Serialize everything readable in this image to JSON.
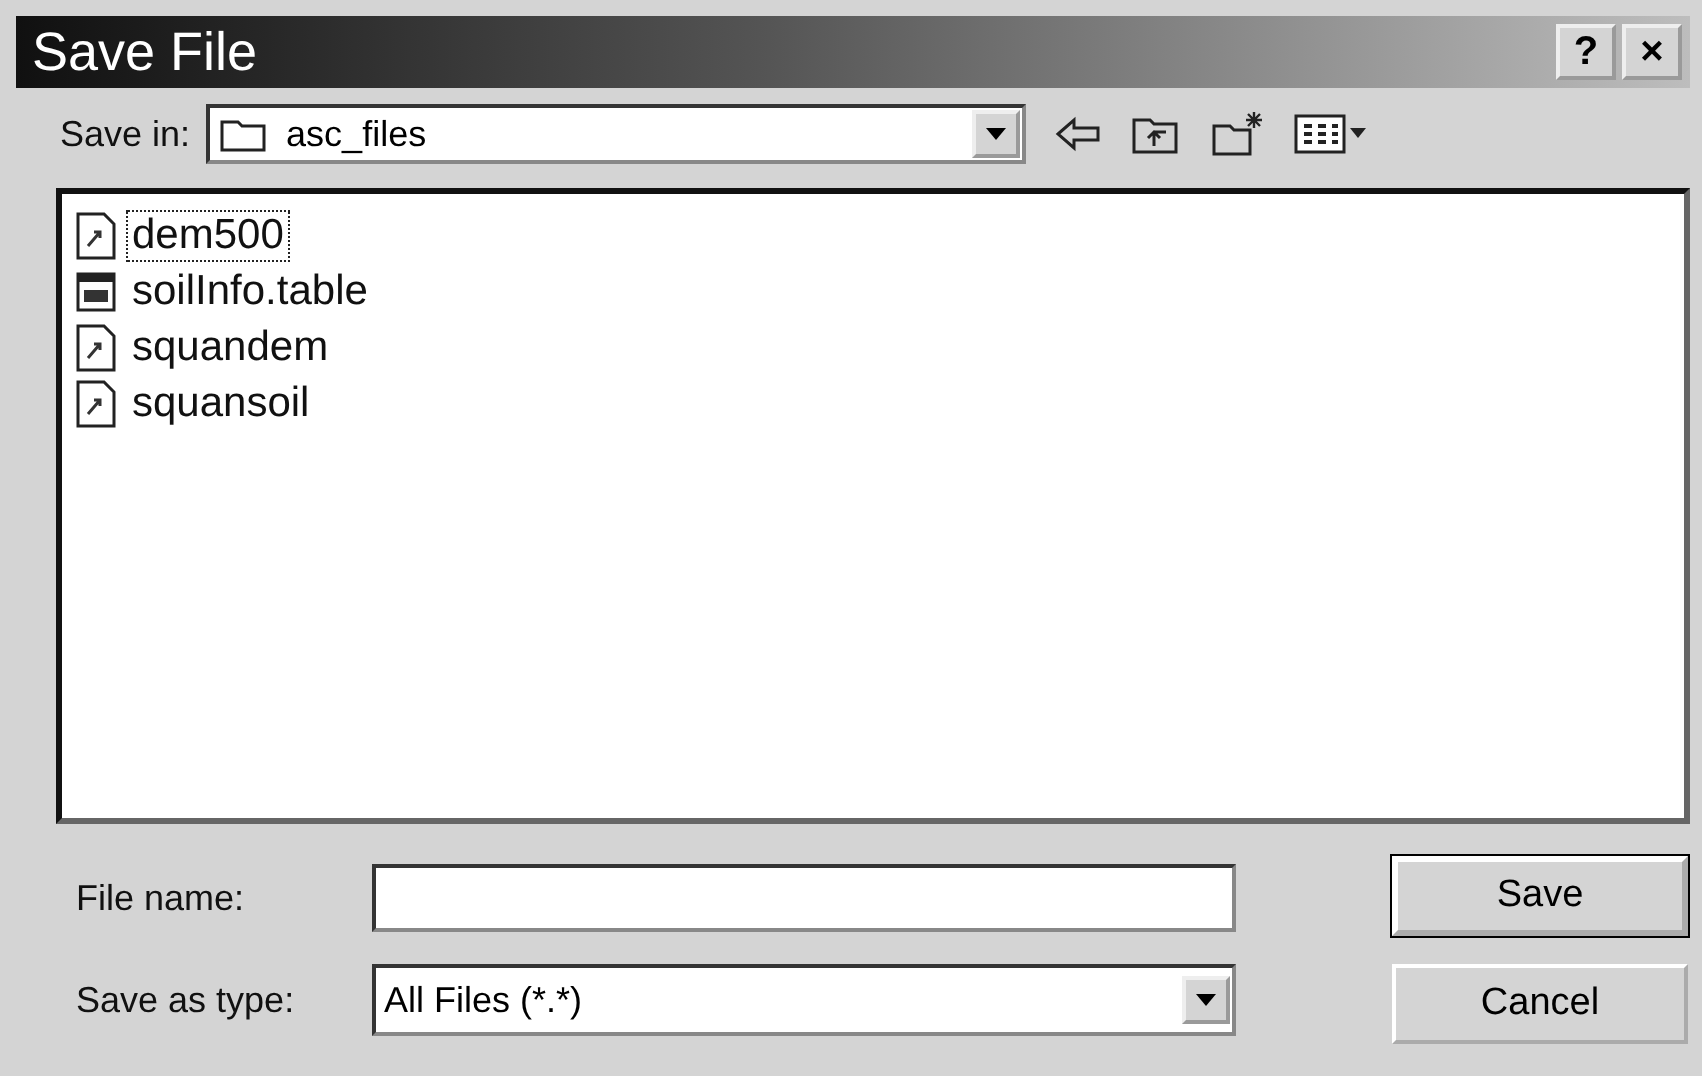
{
  "window": {
    "title": "Save File",
    "buttons": [
      "?",
      "×"
    ]
  },
  "save_in": {
    "label": "Save in:",
    "value": "asc_files"
  },
  "files": [
    {
      "name": "dem500",
      "kind": "data",
      "selected": true
    },
    {
      "name": "soilInfo.table",
      "kind": "table",
      "selected": false
    },
    {
      "name": "squandem",
      "kind": "data",
      "selected": false
    },
    {
      "name": "squansoil",
      "kind": "data",
      "selected": false
    }
  ],
  "file_name": {
    "label": "File name:"
  },
  "save_as_type": {
    "label": "Save as type:",
    "value": "All Files (*.*)"
  },
  "buttons": [
    "Save",
    "Cancel"
  ]
}
